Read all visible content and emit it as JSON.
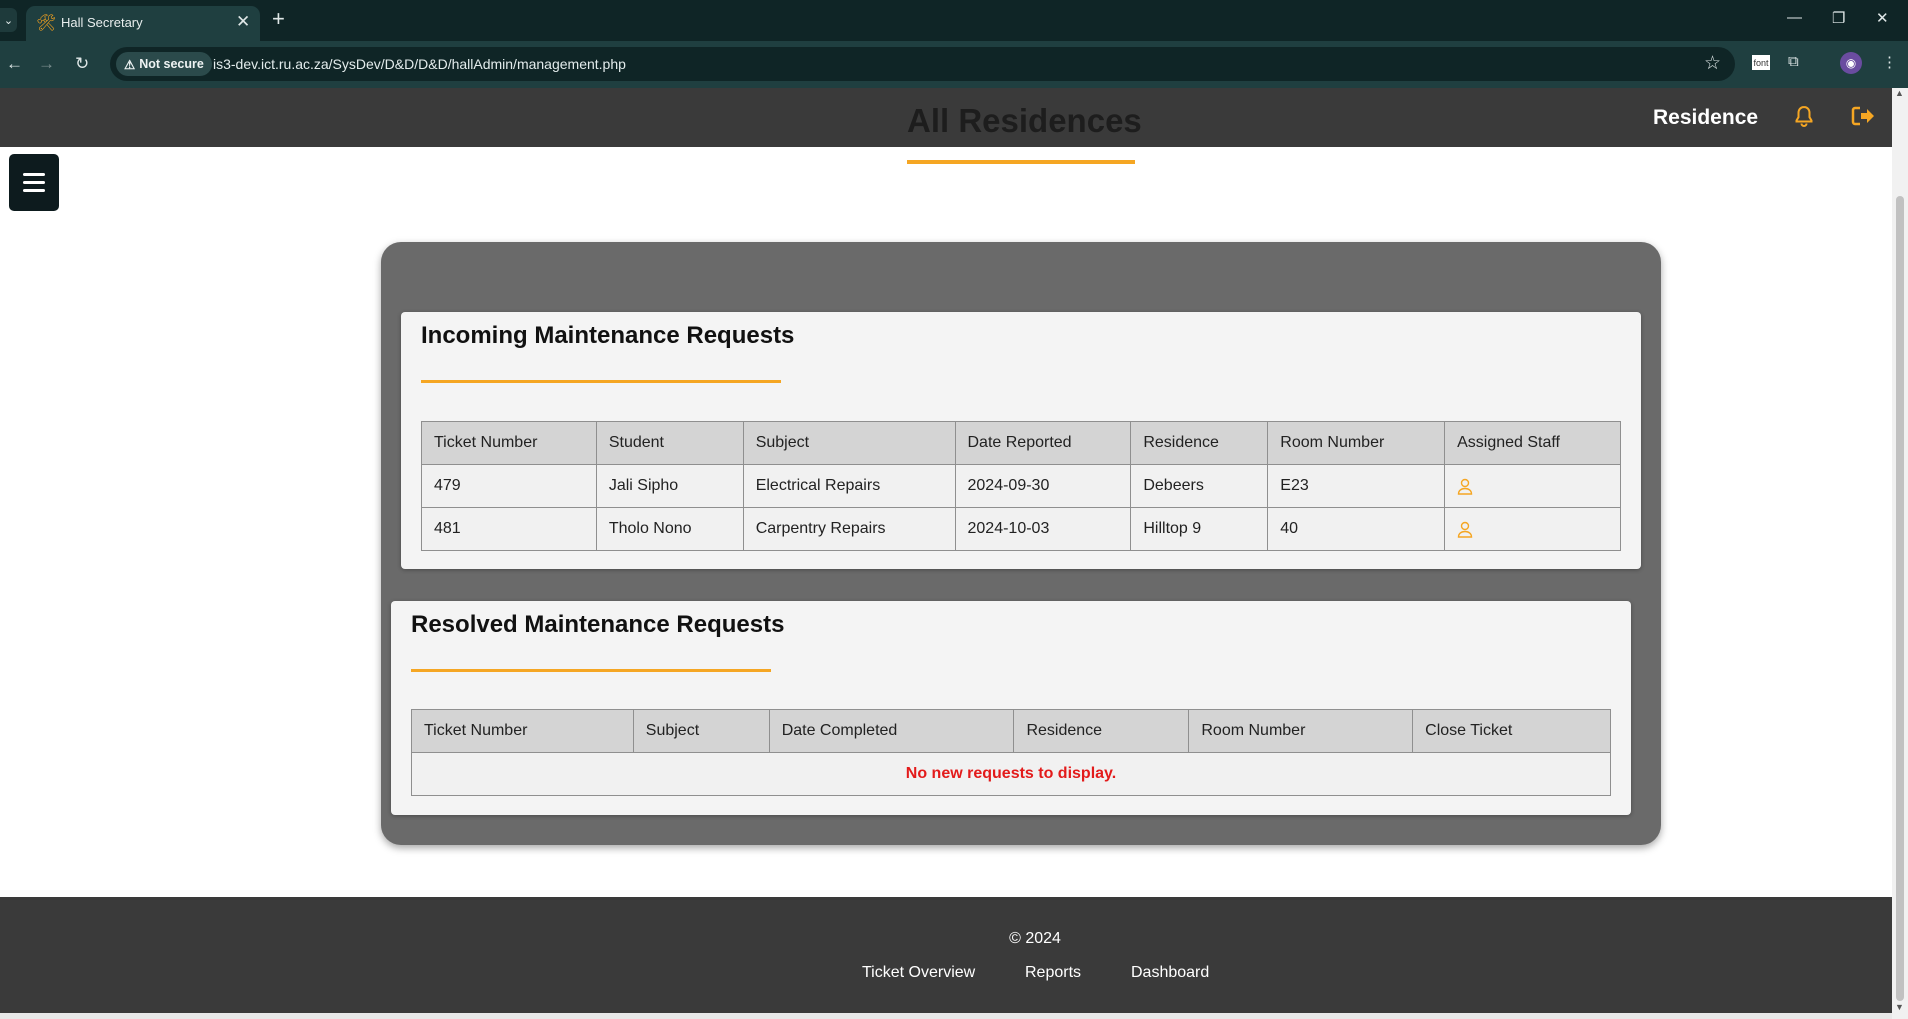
{
  "browser": {
    "tab_title": "Hall Secretary",
    "tab_favicon": "tools-icon",
    "security_label": "Not secure",
    "url": "is3-dev.ict.ru.ac.za/SysDev/D&D/D&D/hallAdmin/management.php",
    "extension_label": "font"
  },
  "header": {
    "title": "All Residences",
    "residence_label": "Residence",
    "accent_color": "#f5a623"
  },
  "incoming": {
    "title": "Incoming Maintenance Requests",
    "columns": [
      "Ticket Number",
      "Student",
      "Subject",
      "Date Reported",
      "Residence",
      "Room Number",
      "Assigned Staff"
    ],
    "rows": [
      {
        "ticket": "479",
        "student": "Jali Sipho",
        "subject": "Electrical Repairs",
        "date": "2024-09-30",
        "residence": "Debeers",
        "room": "E23",
        "staff_icon": "user-icon"
      },
      {
        "ticket": "481",
        "student": "Tholo Nono",
        "subject": "Carpentry Repairs",
        "date": "2024-10-03",
        "residence": "Hilltop 9",
        "room": "40",
        "staff_icon": "user-icon"
      }
    ]
  },
  "resolved": {
    "title": "Resolved Maintenance Requests",
    "columns": [
      "Ticket Number",
      "Subject",
      "Date Completed",
      "Residence",
      "Room Number",
      "Close Ticket"
    ],
    "empty_message": "No new requests to display.",
    "empty_color": "#e31b1b"
  },
  "footer": {
    "copyright": "© 2024",
    "links": [
      "Ticket Overview",
      "Reports",
      "Dashboard"
    ]
  }
}
